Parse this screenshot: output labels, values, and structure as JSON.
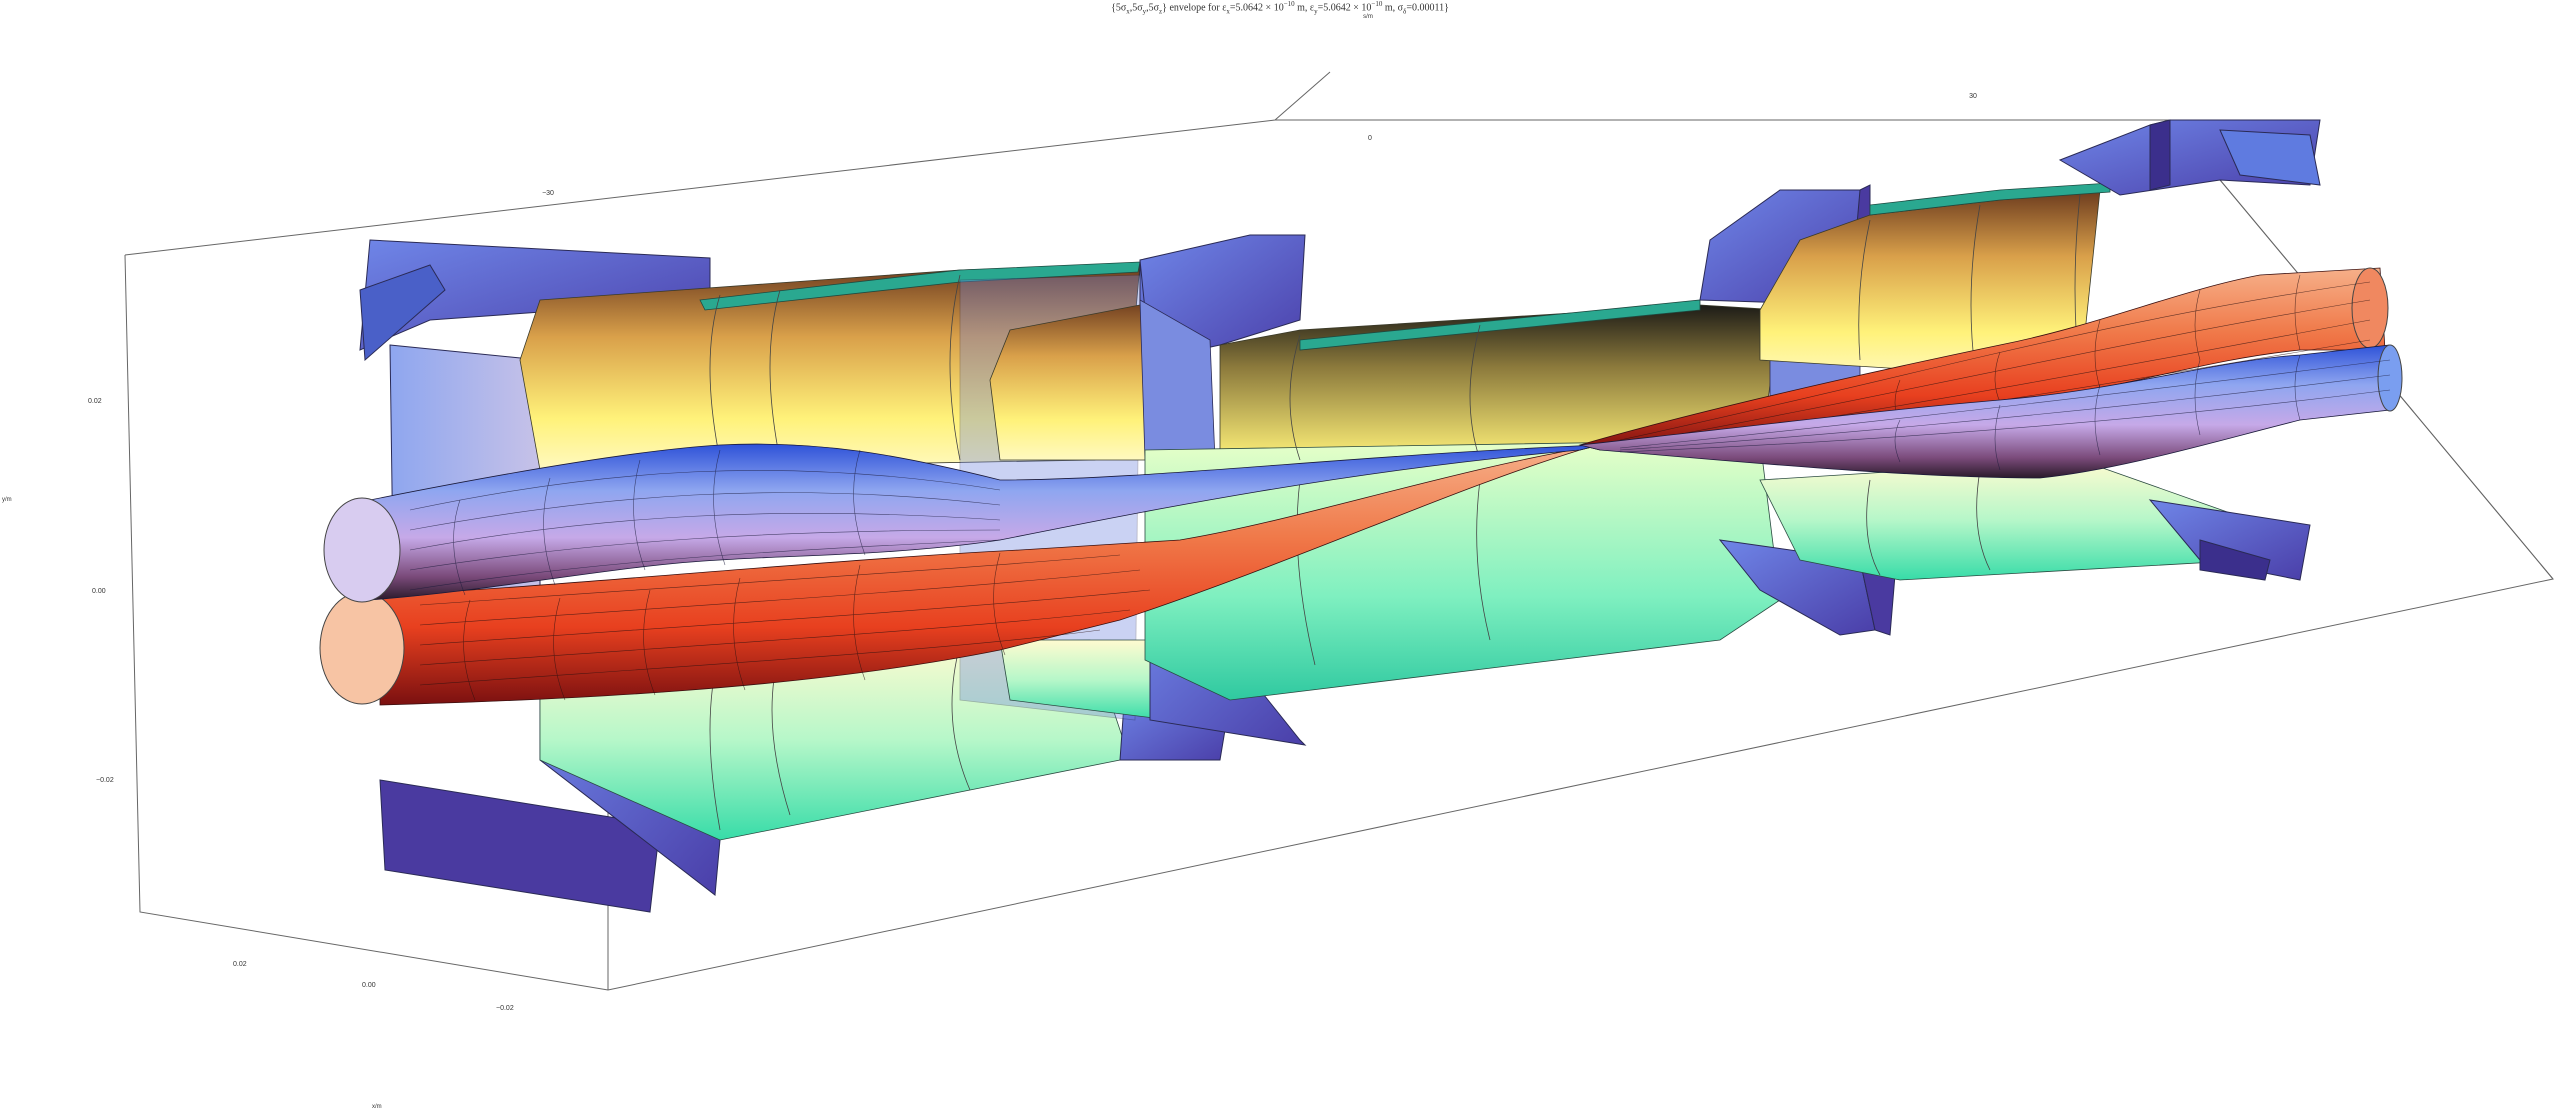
{
  "title": {
    "prefix": "{5σ",
    "sub1": "x",
    "mid1": ",5σ",
    "sub2": "y",
    "mid2": ",5σ",
    "sub3": "z",
    "mid3": "} envelope for ε",
    "sub4": "x",
    "mid4": "=5.0642 × 10",
    "sup1": "−10",
    "mid5": " m, ε",
    "sub5": "y",
    "mid6": "=5.0642 × 10",
    "sup2": "−10",
    "mid7": " m, σ",
    "sub6": "δ",
    "suffix": "=0.00011}"
  },
  "axes": {
    "z_top_label": "s/m",
    "z_top_ticks": [
      "−30",
      "0",
      "30"
    ],
    "y_left_label": "y/m",
    "y_left_ticks": [
      "0.02",
      "0.00",
      "−0.02"
    ],
    "x_bottom_label": "x/m",
    "x_bottom_ticks": [
      "0.02",
      "0.00",
      "−0.02"
    ]
  },
  "colors": {
    "beam_blue": "#5b7fe0",
    "beam_red": "#e8452a",
    "magnet_yellow": "#ffee88",
    "magnet_green": "#4fe6b0",
    "flange_blue": "#5a6fd0",
    "flange_dark": "#3b2f8c"
  }
}
